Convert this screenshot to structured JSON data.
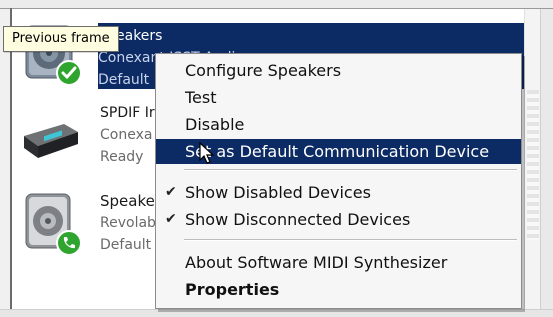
{
  "tooltip": "Previous frame",
  "devices": [
    {
      "name": "Speakers",
      "driver": "Conexant ISST Audio",
      "status": "Default Device",
      "icon": "speaker-icon",
      "badge": "default-check-icon"
    },
    {
      "name": "SPDIF Interface",
      "driver": "Conexant",
      "status": "Ready",
      "icon": "receiver-device-icon"
    },
    {
      "name": "Speakers",
      "driver": "Revolabs",
      "status": "Default Communication Device",
      "icon": "speaker-icon",
      "badge": "phone-badge-icon"
    }
  ],
  "device_text": {
    "d1_name": "eakers",
    "d1_driver": "Conexant ISST Audio",
    "d1_status": "Default Device",
    "d2_name": "SPDIF Ir",
    "d2_driver": "Conexa",
    "d2_status": "Ready",
    "d3_name": "Speake",
    "d3_driver": "Revolab",
    "d3_status": "Default"
  },
  "menu": {
    "items": [
      {
        "label": "Configure Speakers"
      },
      {
        "label": "Test"
      },
      {
        "label": "Disable"
      },
      {
        "label": "Set as Default Communication Device",
        "highlighted": true
      },
      {
        "label": "Show Disabled Devices",
        "checked": true
      },
      {
        "label": "Show Disconnected Devices",
        "checked": true
      },
      {
        "label": "About Software MIDI Synthesizer"
      },
      {
        "label": "Properties",
        "bold": true
      }
    ]
  },
  "colors": {
    "selection": "#0c2a63",
    "badge_green": "#2fa52f",
    "tooltip_bg": "#fffde0"
  }
}
